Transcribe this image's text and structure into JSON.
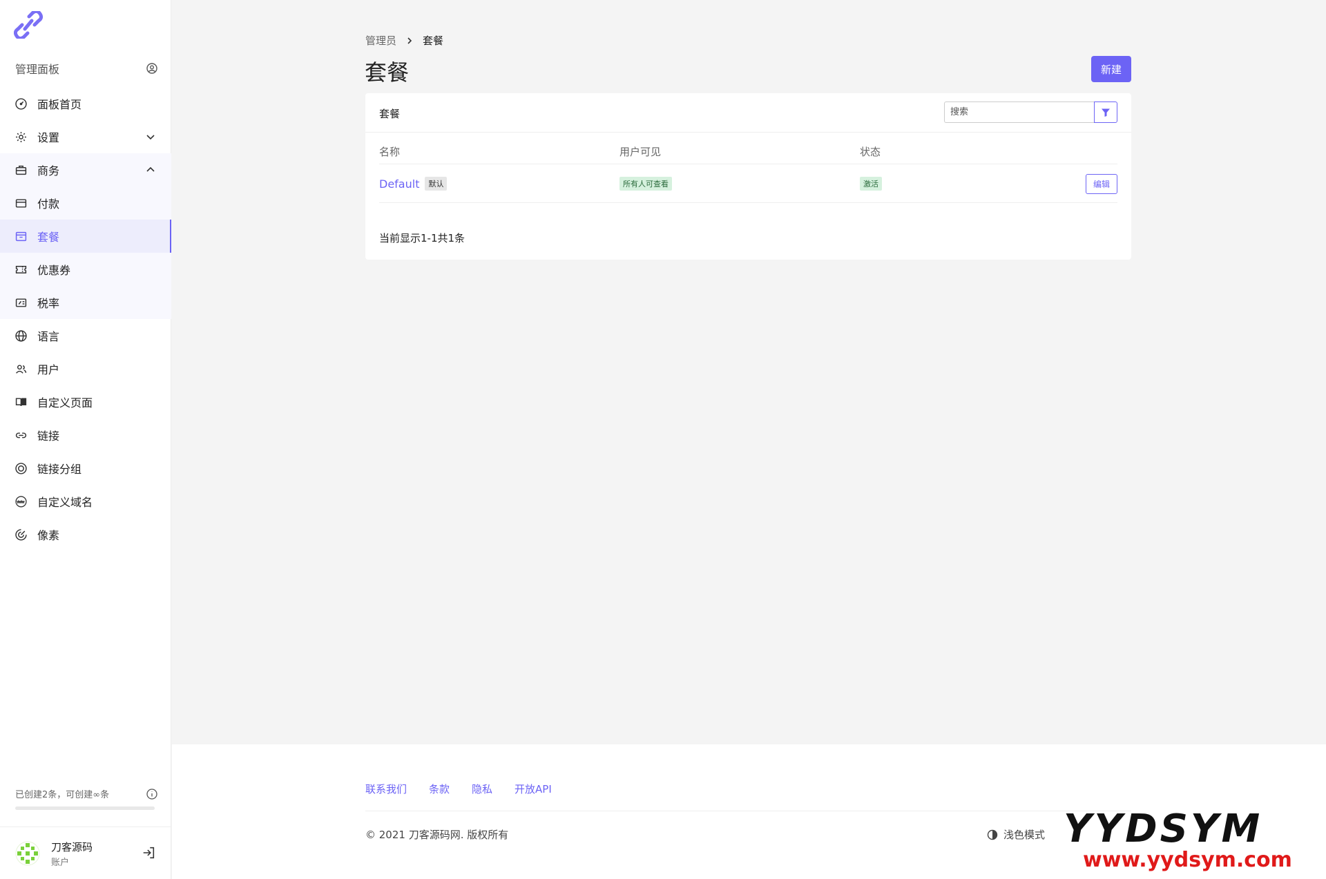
{
  "sidebar": {
    "header_label": "管理面板",
    "items": [
      {
        "label": "面板首页"
      },
      {
        "label": "设置"
      },
      {
        "label": "商务"
      },
      {
        "label": "付款"
      },
      {
        "label": "套餐"
      },
      {
        "label": "优惠券"
      },
      {
        "label": "税率"
      },
      {
        "label": "语言"
      },
      {
        "label": "用户"
      },
      {
        "label": "自定义页面"
      },
      {
        "label": "链接"
      },
      {
        "label": "链接分组"
      },
      {
        "label": "自定义域名"
      },
      {
        "label": "像素"
      }
    ],
    "quota_text": "已创建2条，可创建∞条",
    "account": {
      "name": "刀客源码",
      "sub": "账户"
    }
  },
  "breadcrumb": {
    "parent": "管理员",
    "current": "套餐"
  },
  "page": {
    "title": "套餐",
    "new_button": "新建"
  },
  "card": {
    "title": "套餐",
    "search_placeholder": "搜索",
    "columns": [
      "名称",
      "用户可见",
      "状态"
    ],
    "rows": [
      {
        "name": "Default",
        "default_badge": "默认",
        "visibility": "所有人可查看",
        "status": "激活",
        "edit_label": "编辑"
      }
    ],
    "pagination": "当前显示1-1共1条"
  },
  "footer": {
    "links": [
      "联系我们",
      "条款",
      "隐私",
      "开放API"
    ],
    "copyright": "© 2021 刀客源码网. 版权所有",
    "theme_toggle": "浅色模式"
  },
  "watermark": {
    "top": "YYDSYM",
    "bottom": "www.yydsym.com"
  },
  "colors": {
    "accent": "#6c63f5",
    "badge_green_bg": "#d6f1de",
    "badge_gray_bg": "#e6e6e6"
  }
}
